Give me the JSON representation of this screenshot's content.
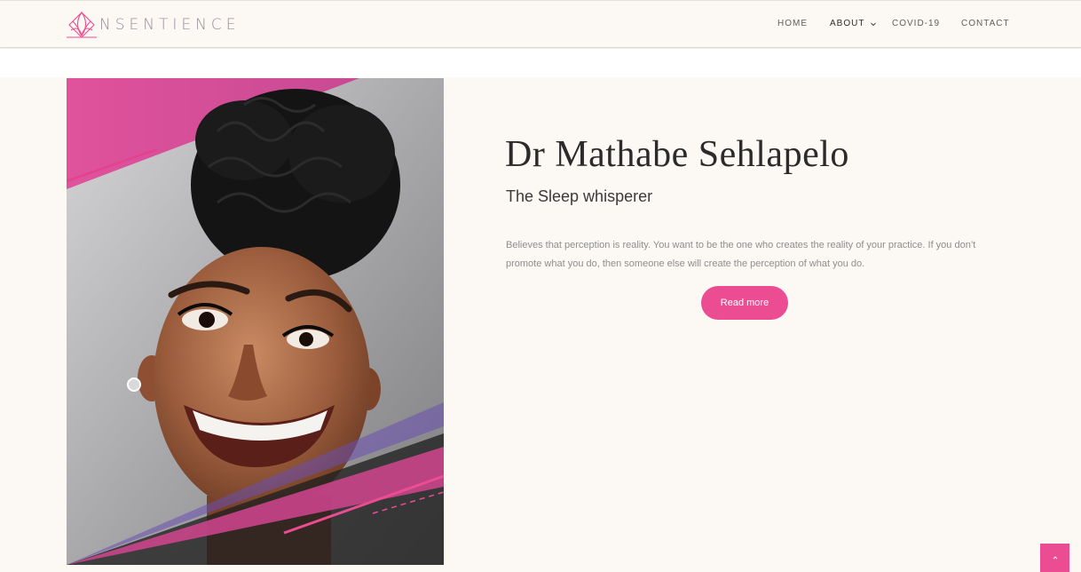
{
  "brand": {
    "name": "NSENTIENCE",
    "accent": "#ec4d92",
    "logo_color": "#9a8c9c"
  },
  "nav": {
    "items": [
      {
        "label": "HOME"
      },
      {
        "label": "ABOUT",
        "active": true,
        "has_dropdown": true
      },
      {
        "label": "COVID-19"
      },
      {
        "label": "CONTACT"
      }
    ],
    "chevron_icon": "chevron-down-icon"
  },
  "profile": {
    "name": "Dr Mathabe Sehlapelo",
    "subtitle": "The Sleep whisperer",
    "bio": "Believes that perception is reality. You want to be the one who creates the reality of your practice. If you don’t promote what you do, then someone else will create the perception of what you do.",
    "cta_label": "Read more"
  },
  "scroll_top_icon": "chevron-up-icon"
}
